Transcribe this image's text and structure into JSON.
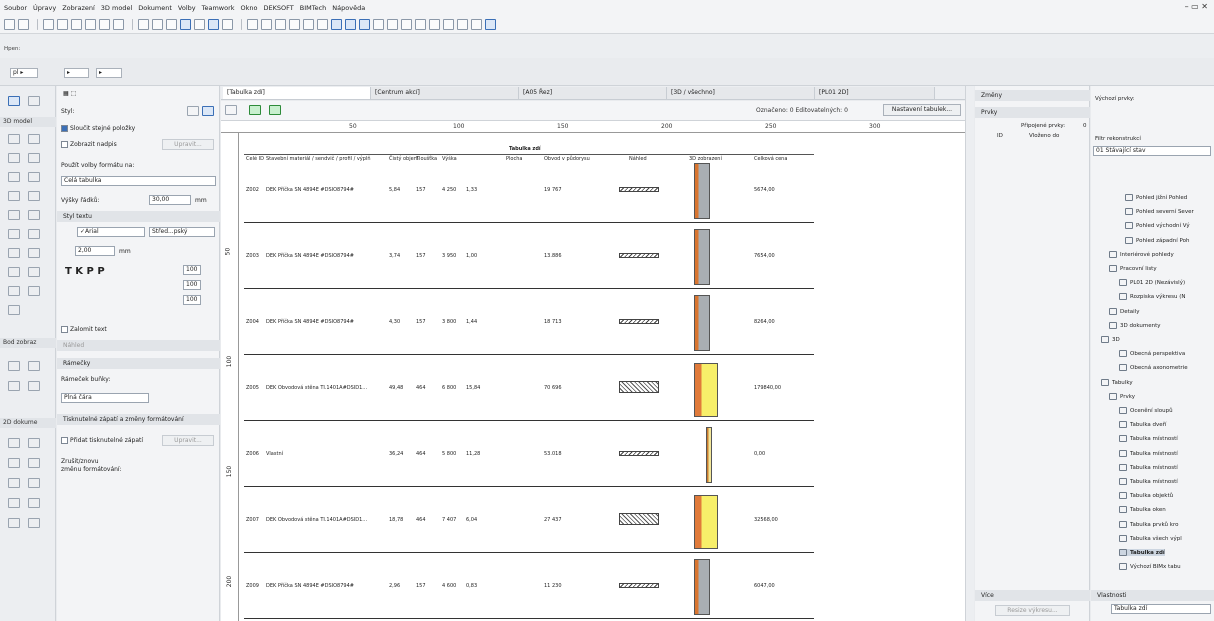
{
  "menu": [
    "Soubor",
    "Úpravy",
    "Zobrazení",
    "3D model",
    "Dokument",
    "Volby",
    "Teamwork",
    "Okno",
    "DEKSOFT",
    "BIMTech",
    "Nápověda"
  ],
  "window_controls": "– ▭ ✕",
  "info_label": "Hpen:",
  "left_panel": {
    "section_3d": "3D model",
    "style_label": "Styl:",
    "merge": "Sloučit stejné položky",
    "show_header": "Zobrazit nadpis",
    "edit_btn": "Upravit...",
    "format_label": "Použít volby formátu na:",
    "format_value": "Celá tabulka",
    "row_height": "Výšky řádků:",
    "row_height_val": "30,00",
    "unit": "mm",
    "text_style": "Styl textu",
    "font": "✓Arial",
    "align": "Střed...pský",
    "size_val": "2,00",
    "wrap": "Zalomit text",
    "sec_body": "Bod zobraz",
    "preview": "Náhled",
    "frames": "Rámečky",
    "cell_frame": "Rámeček buňky:",
    "line": "Plná čára",
    "sec_2d": "2D dokume",
    "footer": "Tisknutelné zápatí a změny formátování",
    "add_footer": "Přidat tisknutelné zápatí",
    "edit_btn2": "Upravit...",
    "undo": "Zrušit/znovu",
    "undo2": "změnu formátování:",
    "pct1": "100",
    "pct2": "100",
    "pct3": "100"
  },
  "tabs": [
    "[Tabulka zdí]",
    "[Centrum akcí]",
    "[A05 Řez]",
    "[3D / všechno]",
    "[PL01 2D]"
  ],
  "doc_status": "Označeno: 0  Editovatelných: 0",
  "doc_button": "Nastavení tabulek...",
  "ruler": [
    "50",
    "100",
    "150",
    "200",
    "250",
    "300"
  ],
  "vruler": [
    "50",
    "100",
    "150",
    "200"
  ],
  "table": {
    "title": "Tabulka zdí",
    "headers": [
      "Celé ID",
      "Stavební materiál / sendvič / profil / výplň",
      "Čistý objem",
      "Tloušťka",
      "Výška",
      "Plocha",
      "Obvod v půdorysu",
      "Náhled",
      "3D zobrazení",
      "Celková cena"
    ],
    "rows": [
      {
        "id": "Z002",
        "mat": "DEK Příčka SN 4894E #DSIO8794#",
        "vol": "5,84",
        "th": "157",
        "h": "4 250",
        "a": "1,33",
        "p": "19 767",
        "price": "5674,00"
      },
      {
        "id": "Z003",
        "mat": "DEK Příčka SN 4894E #DSIO8794#",
        "vol": "3,74",
        "th": "157",
        "h": "3 950",
        "a": "1,00",
        "p": "13.886",
        "price": "7654,00"
      },
      {
        "id": "Z004",
        "mat": "DEK Příčka SN 4894E #DSIO8794#",
        "vol": "4,30",
        "th": "157",
        "h": "3 800",
        "a": "1,44",
        "p": "18 713",
        "price": "8264,00"
      },
      {
        "id": "Z005",
        "mat": "DEK Obvodová stěna TI.1401A#DSID1...",
        "vol": "49,48",
        "th": "464",
        "h": "6 800",
        "a": "15,84",
        "p": "70 696",
        "price": "179840,00"
      },
      {
        "id": "Z006",
        "mat": "Vlastní",
        "vol": "36,24",
        "th": "464",
        "h": "5 800",
        "a": "11,28",
        "p": "53.018",
        "price": "0,00"
      },
      {
        "id": "Z007",
        "mat": "DEK Obvodová stěna TI.1401A#DSID1...",
        "vol": "18,78",
        "th": "464",
        "h": "7 407",
        "a": "6,04",
        "p": "27 437",
        "price": "32568,00"
      },
      {
        "id": "Z009",
        "mat": "DEK Příčka SN 4894E #DSIO8794#",
        "vol": "2,96",
        "th": "157",
        "h": "4 600",
        "a": "0,83",
        "p": "11 230",
        "price": "6047,00"
      }
    ]
  },
  "changes": {
    "zmeny": "Změny",
    "prvky": "Prvky",
    "attached": "Připojené prvky:",
    "zero": "0",
    "id": "ID",
    "inserted": "Vloženo do",
    "vice": "Více",
    "resize": "Resize výkresu..."
  },
  "nav": {
    "default": "Výchozí prvky:",
    "filter": "Filtr rekonstrukcí",
    "filter_val": "01 Stávající stav",
    "items": [
      "Pohled jižní Pohled",
      "Pohled severní Sever",
      "Pohled východní Vý",
      "Pohled západní Poh",
      "Interiérové pohledy",
      "Pracovní listy",
      "PL01 2D (Nezávislý)",
      "Rozpiska výkresu (N",
      "Detaily",
      "3D dokumenty",
      "3D",
      "Obecná perspektiva",
      "Obecná axonometrie",
      "Tabulky",
      "Prvky",
      "Ocenění sloupů",
      "Tabulka dveří",
      "Tabulka místností",
      "Tabulka místností",
      "Tabulka místností",
      "Tabulka místností",
      "Tabulka objektů",
      "Tabulka oken",
      "Tabulka prvků kro",
      "Tabulka všech výpl",
      "Tabulka zdí",
      "Výchozí BIMx tabu"
    ],
    "props": "Vlastnosti",
    "props_val": "Tabulka zdí"
  }
}
